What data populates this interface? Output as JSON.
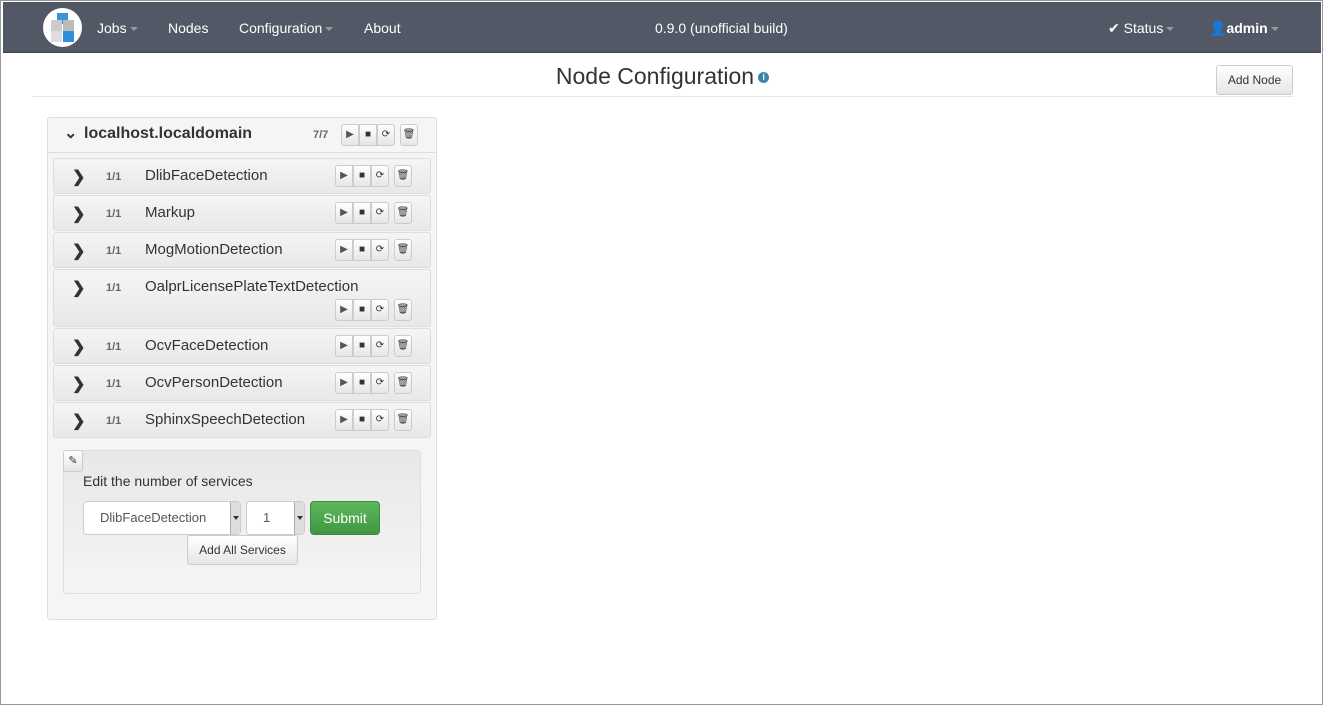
{
  "nav": {
    "items": [
      {
        "label": "Jobs",
        "dropdown": true
      },
      {
        "label": "Nodes"
      },
      {
        "label": "Configuration",
        "dropdown": true
      },
      {
        "label": "About"
      }
    ],
    "version": "0.9.0 (unofficial build)",
    "status": "Status",
    "user": "admin"
  },
  "page": {
    "title": "Node Configuration",
    "add_node": "Add Node"
  },
  "node": {
    "name": "localhost.localdomain",
    "count": "7/7",
    "services": [
      {
        "count": "1/1",
        "name": "DlibFaceDetection"
      },
      {
        "count": "1/1",
        "name": "Markup"
      },
      {
        "count": "1/1",
        "name": "MogMotionDetection"
      },
      {
        "count": "1/1",
        "name": "OalprLicensePlateTextDetection"
      },
      {
        "count": "1/1",
        "name": "OcvFaceDetection"
      },
      {
        "count": "1/1",
        "name": "OcvPersonDetection"
      },
      {
        "count": "1/1",
        "name": "SphinxSpeechDetection"
      }
    ]
  },
  "edit": {
    "label": "Edit the number of services",
    "service_select": "DlibFaceDetection",
    "count_select": "1",
    "submit": "Submit",
    "add_all": "Add All Services"
  },
  "colors": {
    "navbar": "#525865",
    "submit": "#4cae4c",
    "info": "#3a87ad"
  }
}
